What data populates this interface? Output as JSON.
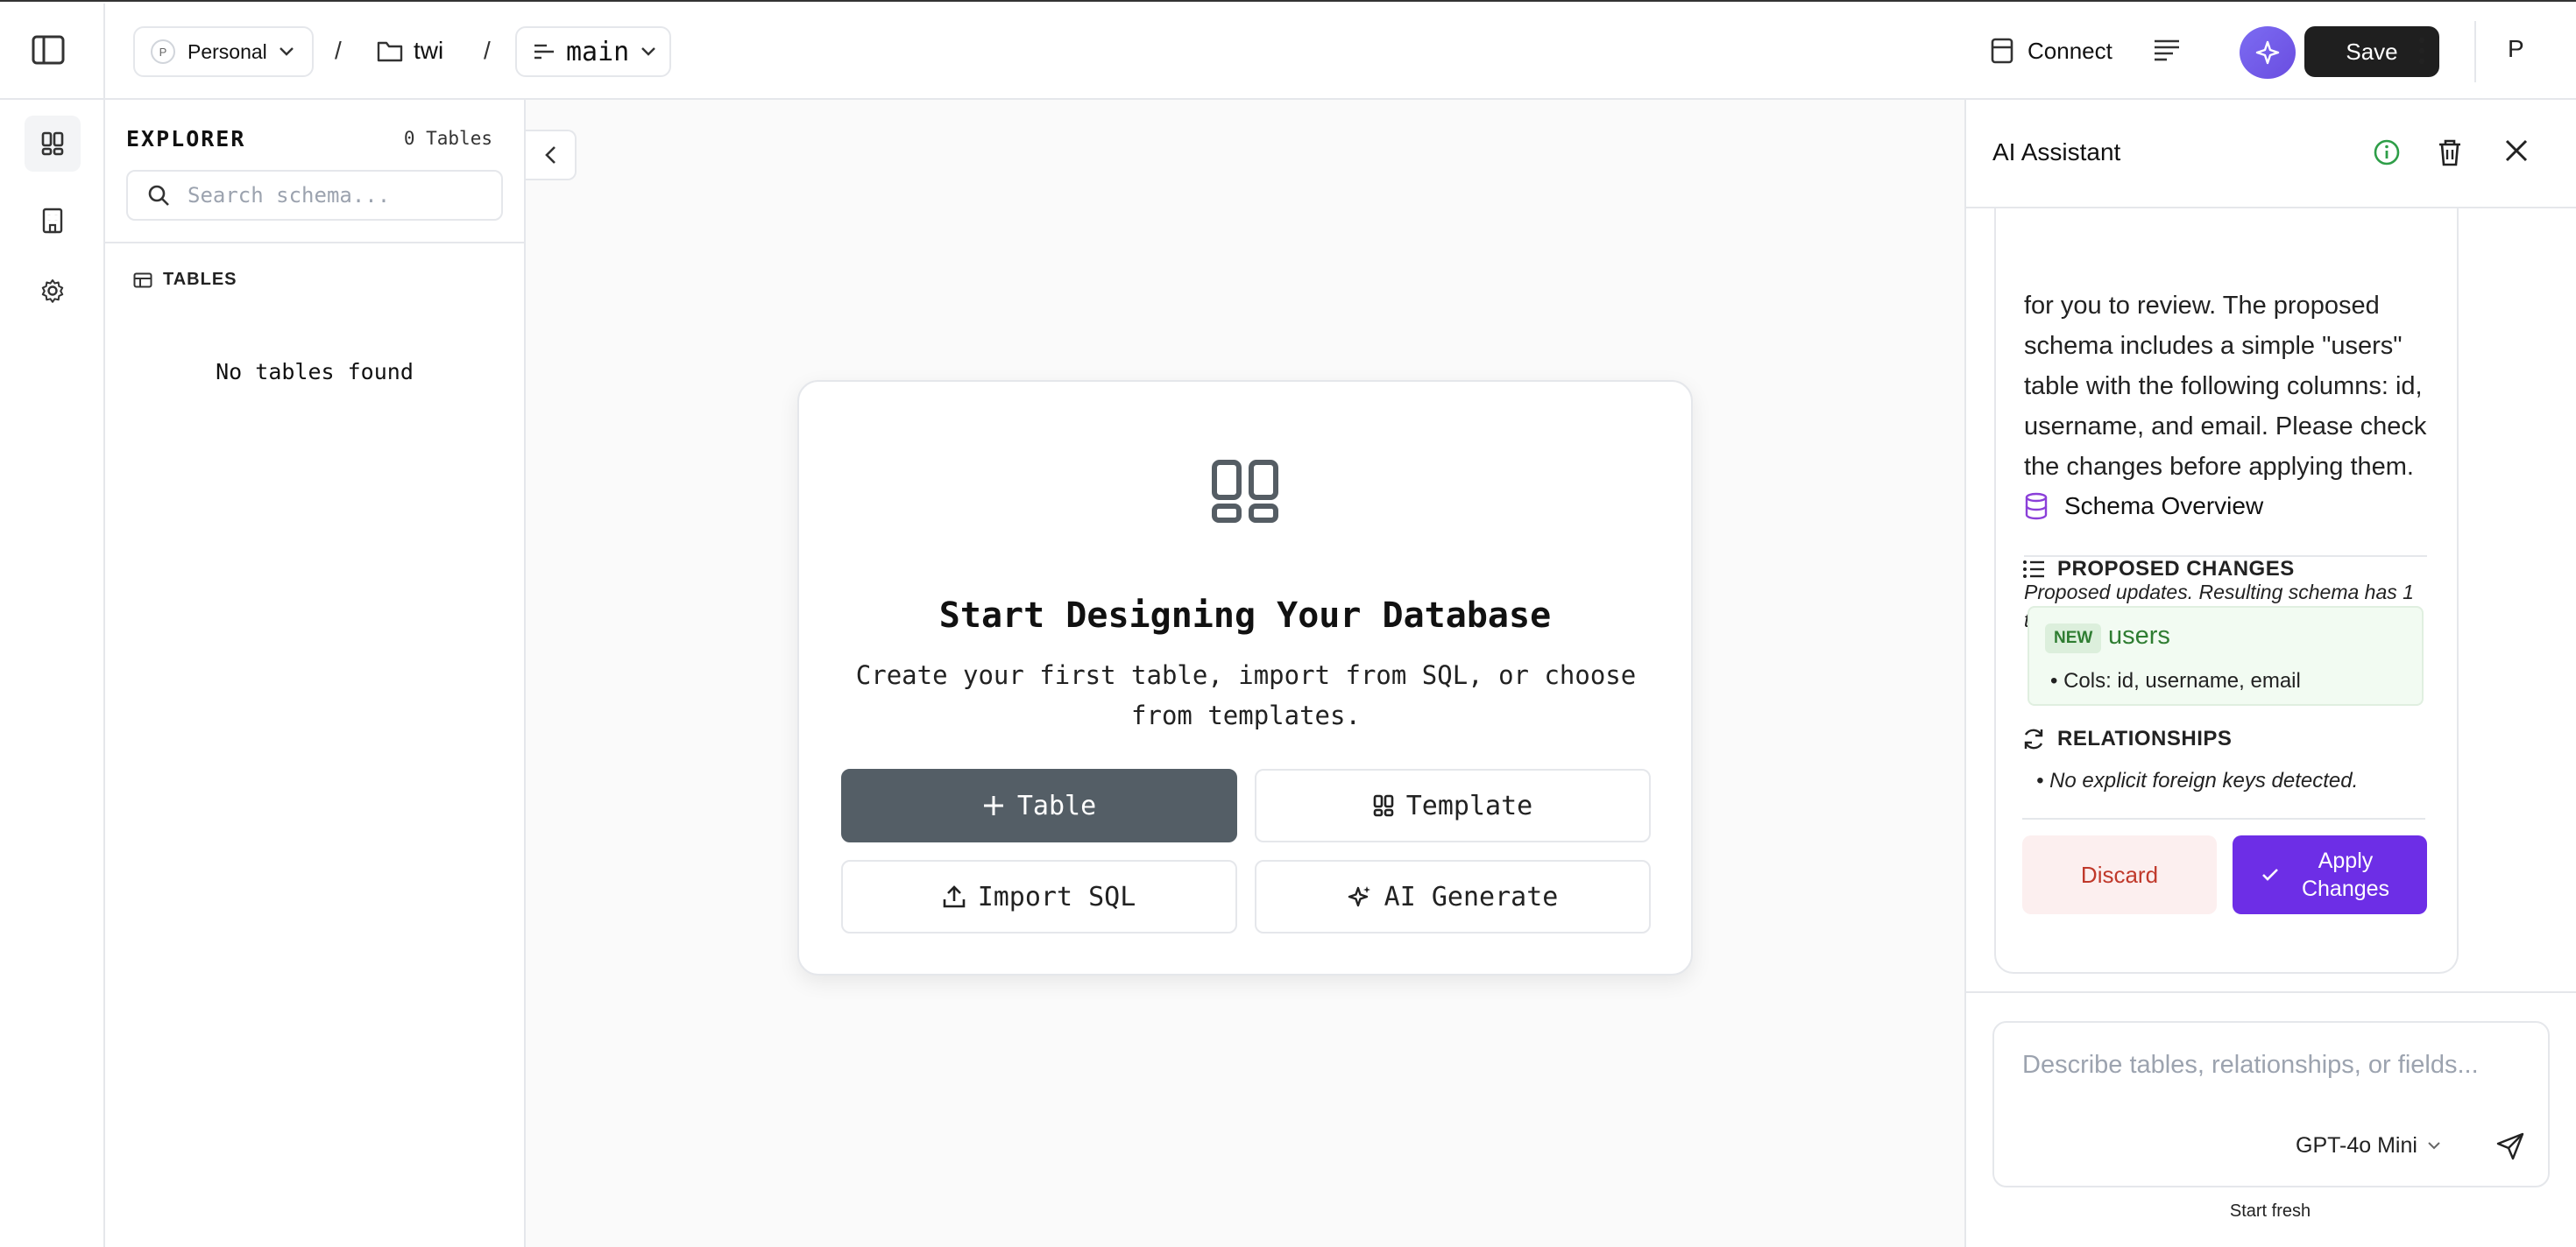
{
  "topbar": {
    "workspace": {
      "avatar_letter": "P",
      "label": "Personal"
    },
    "separator": "/",
    "folder": "twi",
    "branch": "main",
    "connect_label": "Connect",
    "save_label": "Save",
    "user_initial": "P"
  },
  "rail": {
    "items": [
      {
        "icon": "grid-icon",
        "active": true
      },
      {
        "icon": "building-icon",
        "active": false
      },
      {
        "icon": "gear-icon",
        "active": false
      }
    ]
  },
  "explorer": {
    "title": "EXPLORER",
    "count": "0 Tables",
    "search_placeholder": "Search schema...",
    "section_label": "TABLES",
    "empty_text": "No tables found"
  },
  "card": {
    "title": "Start Designing Your Database",
    "subtitle": "Create your first table, import from SQL, or choose from templates.",
    "buttons": {
      "table": "Table",
      "template": "Template",
      "import": "Import SQL",
      "ai": "AI Generate"
    }
  },
  "ai": {
    "title": "AI Assistant",
    "message_text": "for you to review. The proposed schema includes a simple \"users\" table with the following columns: id, username, and email. Please check the changes before applying them.",
    "overview_title": "Schema Overview",
    "overview_note": "Proposed updates. Resulting schema has 1 tables.",
    "proposed_label": "PROPOSED CHANGES",
    "change": {
      "badge": "NEW",
      "name": "users",
      "cols": "• Cols: id, username, email"
    },
    "relationships_label": "RELATIONSHIPS",
    "relationships_note": "No explicit foreign keys detected.",
    "discard_label": "Discard",
    "apply_label": "Apply Changes",
    "input_placeholder": "Describe tables, relationships, or fields...",
    "model": "GPT-4o Mini",
    "start_fresh": "Start fresh"
  },
  "colors": {
    "accent": "#6d2ee6",
    "primary_button": "#545e66",
    "new_green": "#2f7d32",
    "discard_red": "#c0392b"
  }
}
